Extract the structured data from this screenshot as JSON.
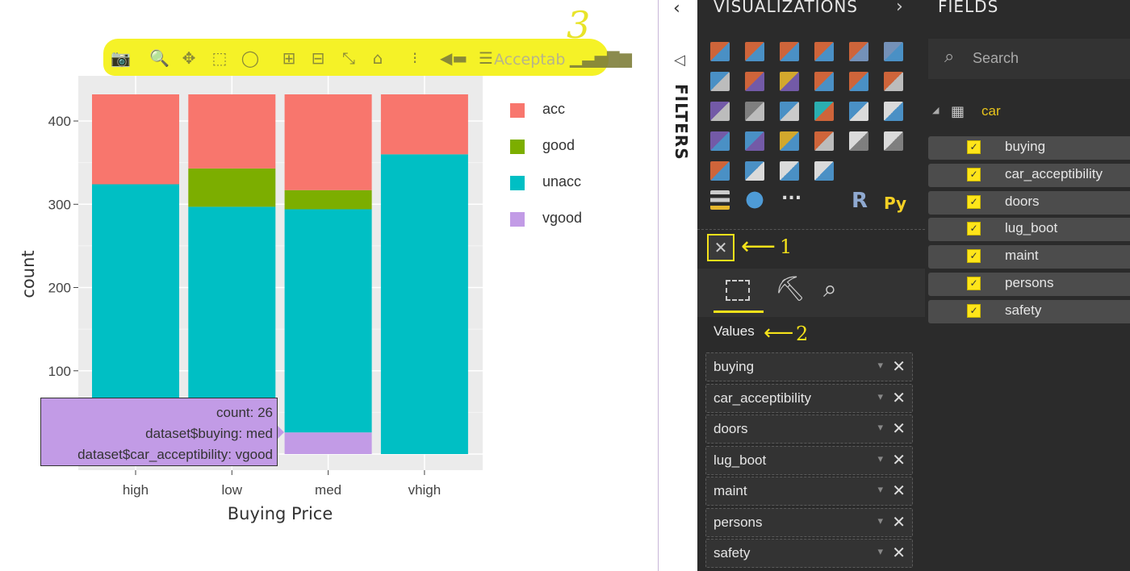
{
  "modebar": {
    "annotation_number": "3",
    "overflow_text": "Acceptab",
    "icons": [
      "camera-icon",
      "zoom-icon",
      "pan-icon",
      "box-select-icon",
      "lasso-icon",
      "zoom-in-icon",
      "zoom-out-icon",
      "autoscale-icon",
      "home-icon",
      "spike-lines-icon",
      "hover-closest-icon",
      "hover-compare-icon",
      "plotly-logo-icon"
    ]
  },
  "chart_data": {
    "type": "bar",
    "stacked": true,
    "categories": [
      "high",
      "low",
      "med",
      "vhigh"
    ],
    "series": [
      {
        "name": "vgood",
        "color": "#c29be6",
        "values": [
          0,
          39,
          26,
          0
        ]
      },
      {
        "name": "unacc",
        "color": "#00bfc4",
        "values": [
          324,
          258,
          268,
          360
        ]
      },
      {
        "name": "good",
        "color": "#7cae00",
        "values": [
          0,
          46,
          23,
          0
        ]
      },
      {
        "name": "acc",
        "color": "#f8766d",
        "values": [
          108,
          89,
          115,
          72
        ]
      }
    ],
    "xlabel": "Buying Price",
    "ylabel": "count",
    "ylim": [
      0,
      432
    ],
    "yticks": [
      100,
      200,
      300,
      400
    ],
    "legend_order": [
      "acc",
      "good",
      "unacc",
      "vgood"
    ],
    "legend_position": "right"
  },
  "tooltip": {
    "line1": "count:  26",
    "line2": "dataset$buying: med",
    "line3": "dataset$car_acceptibility: vgood"
  },
  "filters": {
    "title": "FILTERS"
  },
  "visualizations": {
    "title": "VISUALIZATIONS",
    "more_label": "...",
    "r_label": "R",
    "py_label": "Py",
    "annotation_1": "1",
    "annotation_2": "2",
    "values_label": "Values",
    "values": [
      "buying",
      "car_acceptibility",
      "doors",
      "lug_boot",
      "maint",
      "persons",
      "safety"
    ]
  },
  "fields": {
    "title": "FIELDS",
    "search_placeholder": "Search",
    "table_name": "car",
    "items": [
      "buying",
      "car_acceptibility",
      "doors",
      "lug_boot",
      "maint",
      "persons",
      "safety"
    ]
  }
}
